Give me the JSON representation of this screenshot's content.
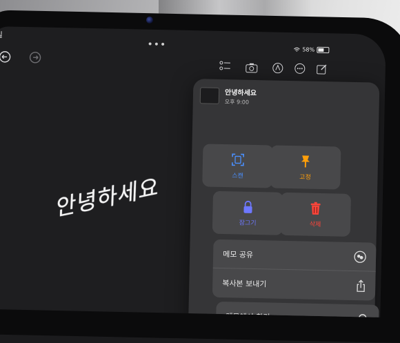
{
  "status": {
    "time": "일",
    "battery": "58%"
  },
  "toolbar": {
    "more_dots": "•••"
  },
  "canvas": {
    "handwriting": "안녕하세요"
  },
  "popover": {
    "note_title": "안녕하세요",
    "note_time": "오후 9:00",
    "actions": [
      {
        "label": "스캔",
        "color": "#4a90ff",
        "icon": "scan-icon"
      },
      {
        "label": "고정",
        "color": "#ff9f0a",
        "icon": "pin-icon"
      },
      {
        "label": "잠그기",
        "color": "#6e78ff",
        "icon": "lock-icon"
      },
      {
        "label": "삭제",
        "color": "#ff453a",
        "icon": "trash-icon"
      }
    ],
    "share_note": "메모 공유",
    "send_copy": "복사본 보내기",
    "find_in_note": "메모에서 찾기"
  }
}
